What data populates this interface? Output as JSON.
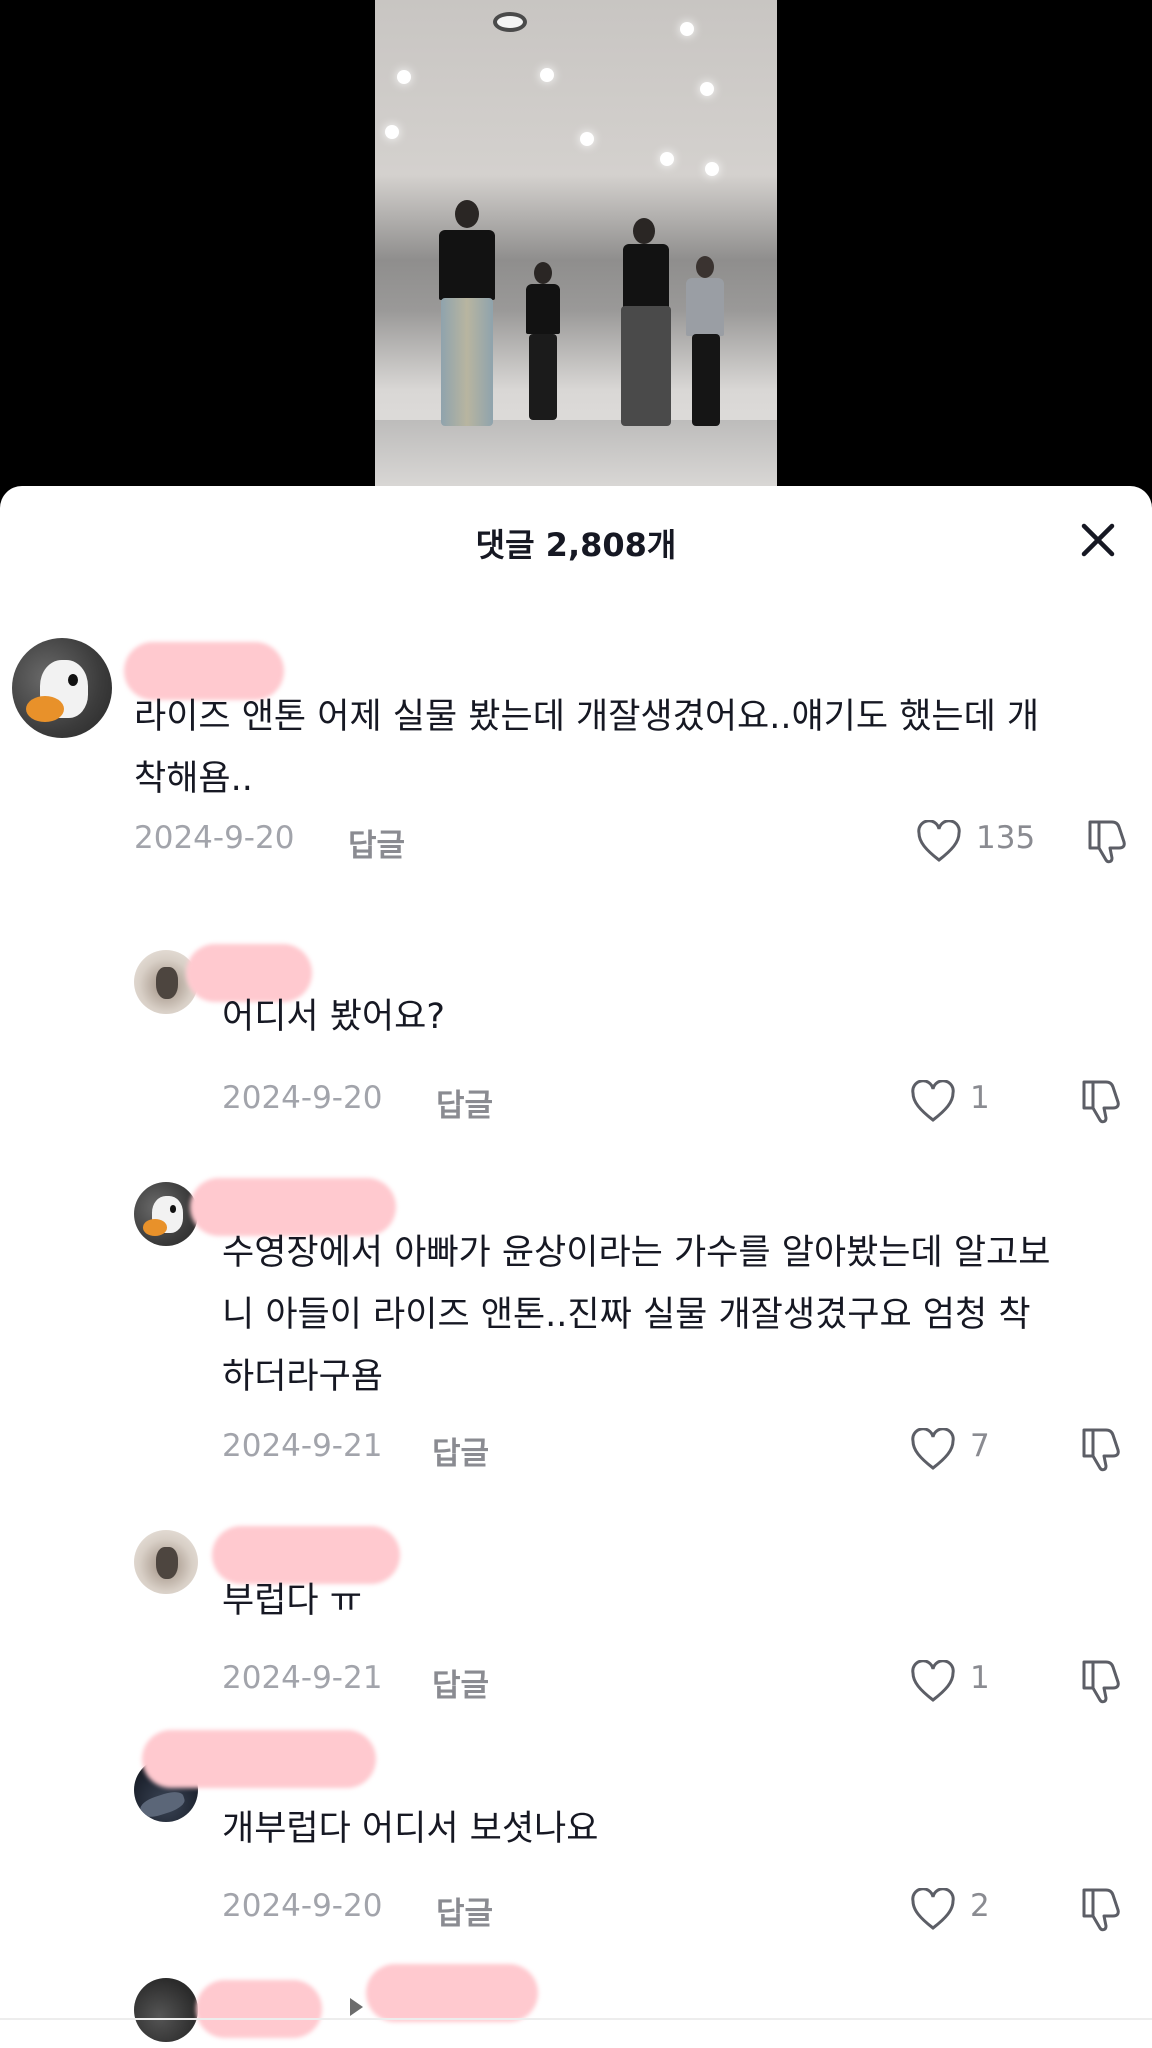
{
  "sheet": {
    "title": "댓글 2,808개",
    "close_icon": "close-icon"
  },
  "comments": [
    {
      "text": "라이즈 앤톤 어제 실물 봤는데 개잘생겼어요..얘기도 했는데 개\n착해욤..",
      "date": "2024-9-20",
      "reply_label": "답글",
      "likes": "135",
      "avatar": "duck-avatar"
    },
    {
      "text": "어디서 봤어요?",
      "date": "2024-9-20",
      "reply_label": "답글",
      "likes": "1",
      "avatar": "cat-avatar"
    },
    {
      "text": "수영장에서 아빠가 윤상이라는 가수를 알아봤는데 알고보\n니 아들이 라이즈 앤톤..진짜 실물 개잘생겼구요 엄청 착\n하더라구욤",
      "date": "2024-9-21",
      "reply_label": "답글",
      "likes": "7",
      "avatar": "duck-avatar"
    },
    {
      "text": "부럽다 ㅠ",
      "date": "2024-9-21",
      "reply_label": "답글",
      "likes": "1",
      "avatar": "cat-avatar"
    },
    {
      "text": "개부럽다 어디서 보셧나요",
      "date": "2024-9-20",
      "reply_label": "답글",
      "likes": "2",
      "avatar": "dark-avatar"
    }
  ],
  "colors": {
    "sheet_bg": "#ffffff",
    "text_primary": "#161823",
    "text_secondary": "#a2a4ab",
    "name_redaction": "#ffc9cf"
  }
}
